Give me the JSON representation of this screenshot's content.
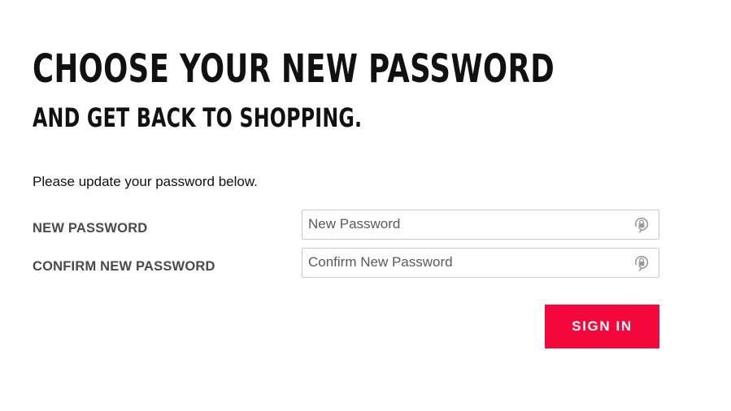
{
  "page": {
    "headline": "CHOOSE YOUR NEW PASSWORD",
    "subheadline": "AND GET BACK TO SHOPPING.",
    "instructions": "Please update your password below."
  },
  "form": {
    "new_password": {
      "label": "NEW PASSWORD",
      "placeholder": "New Password",
      "value": "",
      "icon": "lock-icon"
    },
    "confirm_password": {
      "label": "CONFIRM NEW PASSWORD",
      "placeholder": "Confirm New Password",
      "value": "",
      "icon": "lock-icon"
    },
    "submit_label": "SIGN IN"
  },
  "colors": {
    "accent": "#f4083c",
    "text": "#111111",
    "label": "#4a4a4a",
    "input_border": "#c9c9c9",
    "icon": "#9a9a9a"
  }
}
